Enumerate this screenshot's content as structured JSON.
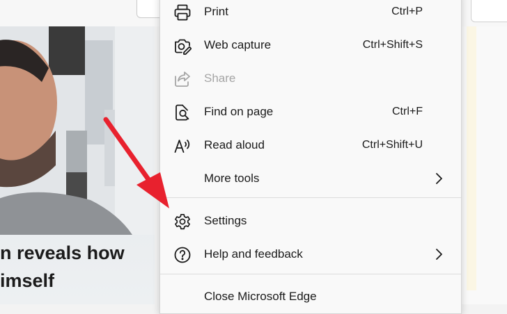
{
  "menu": {
    "items": [
      {
        "id": "print",
        "label": "Print",
        "shortcut": "Ctrl+P",
        "icon": "printer-icon"
      },
      {
        "id": "web-capture",
        "label": "Web capture",
        "shortcut": "Ctrl+Shift+S",
        "icon": "web-capture-icon"
      },
      {
        "id": "share",
        "label": "Share",
        "shortcut": "",
        "icon": "share-icon",
        "disabled": true
      },
      {
        "id": "find-on-page",
        "label": "Find on page",
        "shortcut": "Ctrl+F",
        "icon": "find-icon"
      },
      {
        "id": "read-aloud",
        "label": "Read aloud",
        "shortcut": "Ctrl+Shift+U",
        "icon": "read-aloud-icon"
      },
      {
        "id": "more-tools",
        "label": "More tools",
        "shortcut": "",
        "icon": "",
        "submenu": true
      },
      {
        "id": "settings",
        "label": "Settings",
        "shortcut": "",
        "icon": "gear-icon"
      },
      {
        "id": "help-and-feedback",
        "label": "Help and feedback",
        "shortcut": "",
        "icon": "help-icon",
        "submenu": true
      },
      {
        "id": "close-edge",
        "label": "Close Microsoft Edge",
        "shortcut": "",
        "icon": ""
      }
    ]
  },
  "background": {
    "headline": "n reveals how\nimself"
  },
  "colors": {
    "annotation_arrow": "#e8212e",
    "menu_bg": "#f9f9f9",
    "disabled_text": "#a5a5a5"
  }
}
